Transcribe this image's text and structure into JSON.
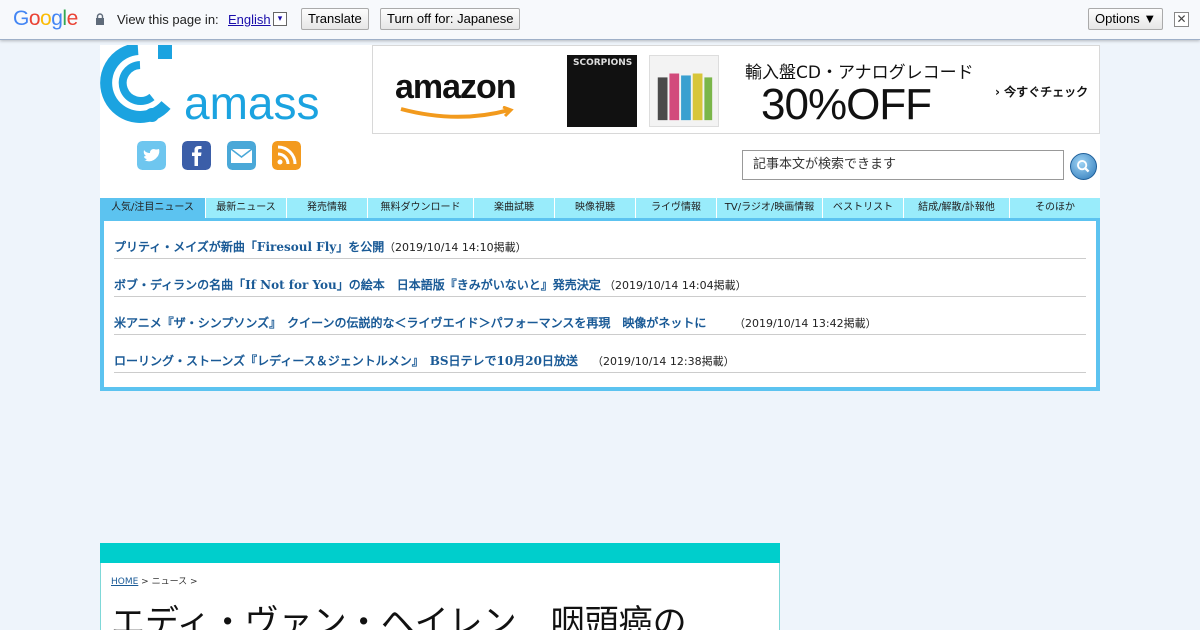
{
  "translate_bar": {
    "view_label": "View this page in:",
    "language": "English",
    "language_arrow": "▾",
    "translate_button": "Translate",
    "turn_off_button": "Turn off for: Japanese",
    "options_button": "Options ▼",
    "close": "✕"
  },
  "site": {
    "logo_text": "amass"
  },
  "ad": {
    "brand": "amazon",
    "album_label": "SCORPIONS",
    "headline": "輸入盤CD・アナログレコード",
    "discount": "30%OFF",
    "cta": "今すぐチェック"
  },
  "search": {
    "placeholder": "記事本文が検索できます"
  },
  "nav": {
    "tabs": [
      {
        "label": "人気/注目ニュース",
        "active": true
      },
      {
        "label": "最新ニュース"
      },
      {
        "label": "発売情報"
      },
      {
        "label": "無料ダウンロード"
      },
      {
        "label": "楽曲試聴"
      },
      {
        "label": "映像視聴"
      },
      {
        "label": "ライヴ情報"
      },
      {
        "label": "TV/ラジオ/映画情報"
      },
      {
        "label": "ベストリスト"
      },
      {
        "label": "結成/解散/訃報他"
      },
      {
        "label": "そのほか"
      }
    ]
  },
  "news": [
    {
      "title": "プリティ・メイズが新曲「Firesoul Fly」を公開",
      "date": "（2019/10/14 14:10掲載）"
    },
    {
      "title": "ボブ・ディランの名曲「If Not for You」の絵本　日本語版『きみがいないと』発売決定",
      "date": "（2019/10/14 14:04掲載）"
    },
    {
      "title": "米アニメ『ザ・シンプソンズ』　クイーンの伝説的な＜ライヴエイド＞パフォーマンスを再現　映像がネットに",
      "date": "（2019/10/14 13:42掲載）"
    },
    {
      "title": "ローリング・ストーンズ『レディース＆ジェントルメン』　BS日テレで10月20日放送",
      "date": "（2019/10/14 12:38掲載）"
    }
  ],
  "article": {
    "breadcrumb_home": "HOME",
    "breadcrumb_rest": " > ニュース > ",
    "title": "エディ・ヴァン・ヘイレン　咽頭癌の"
  },
  "colors": {
    "nav_bg": "#99ecfb",
    "nav_active": "#5cc3f0",
    "news_border": "#5cc3f0",
    "article_header": "#00cecc",
    "link": "#1a5a96"
  }
}
